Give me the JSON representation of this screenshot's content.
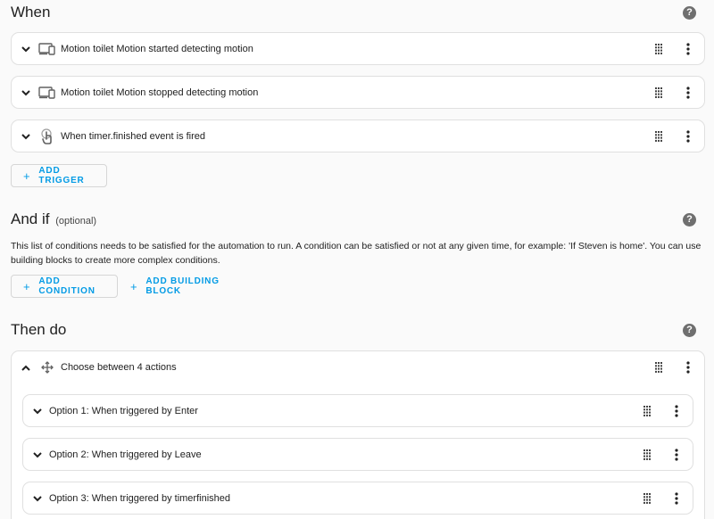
{
  "when": {
    "title": "When",
    "help_icon": "?",
    "triggers": [
      {
        "label": "Motion toilet Motion started detecting motion",
        "icon": "device-icon"
      },
      {
        "label": "Motion toilet Motion stopped detecting motion",
        "icon": "device-icon"
      },
      {
        "label": "When timer.finished event is fired",
        "icon": "touch-icon"
      }
    ],
    "add_trigger": "ADD TRIGGER"
  },
  "and_if": {
    "title": "And if",
    "optional": "(optional)",
    "help_icon": "?",
    "description": "This list of conditions needs to be satisfied for the automation to run. A condition can be satisfied or not at any given time, for example: 'If Steven is home'. You can use building blocks to create more complex conditions.",
    "add_condition": "ADD CONDITION",
    "add_building_block": "ADD BUILDING BLOCK"
  },
  "then_do": {
    "title": "Then do",
    "help_icon": "?",
    "choose": {
      "label": "Choose between 4 actions",
      "options": [
        {
          "label": "Option 1: When triggered by Enter"
        },
        {
          "label": "Option 2: When triggered by Leave"
        },
        {
          "label": "Option 3: When triggered by timerfinished"
        }
      ]
    }
  },
  "plus_symbol": "+",
  "colors": {
    "accent": "#039be5",
    "help_bg": "#6f6f6f",
    "card_border": "#e0e0e0",
    "background": "#fafafa"
  }
}
